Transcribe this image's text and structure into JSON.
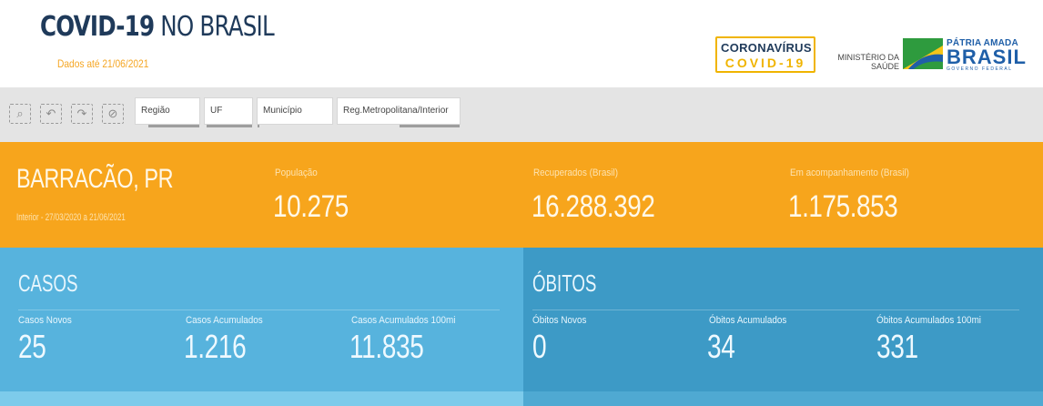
{
  "header": {
    "title_bold": "COVID-19",
    "title_light": " NO BRASIL",
    "date_note": "Dados até 21/06/2021",
    "logo_corona_line1": "CORONAVÍRUS",
    "logo_corona_line2": "COVID-19",
    "logo_ministerio_line1": "MINISTÉRIO DA",
    "logo_ministerio_line2": "SAÚDE",
    "logo_patria_line1": "PÁTRIA AMADA",
    "logo_patria_line2": "BRASIL",
    "logo_patria_line3": "GOVERNO FEDERAL"
  },
  "toolbar": {
    "tools": [
      {
        "icon": "zoom-selection-icon",
        "glyph": "⌕"
      },
      {
        "icon": "back-icon",
        "glyph": "↶"
      },
      {
        "icon": "forward-icon",
        "glyph": "↷"
      },
      {
        "icon": "clear-selection-icon",
        "glyph": "⊘"
      }
    ],
    "filters": [
      "Região",
      "UF",
      "Município",
      "Reg.Metropolitana/Interior"
    ]
  },
  "summary": {
    "city": "BARRACÃO, PR",
    "period": "Interior - 27/03/2020 a 21/06/2021",
    "population_label": "População",
    "population_value": "10.275",
    "recovered_label": "Recuperados (Brasil)",
    "recovered_value": "16.288.392",
    "monitoring_label": "Em acompanhamento (Brasil)",
    "monitoring_value": "1.175.853"
  },
  "casos": {
    "title": "CASOS",
    "new_label": "Casos Novos",
    "new_value": "25",
    "cumulative_label": "Casos Acumulados",
    "cumulative_value": "1.216",
    "per100k_label": "Casos Acumulados 100mi",
    "per100k_value": "11.835"
  },
  "obitos": {
    "title": "ÓBITOS",
    "new_label": "Óbitos Novos",
    "new_value": "0",
    "cumulative_label": "Óbitos Acumulados",
    "cumulative_value": "34",
    "per100k_label": "Óbitos Acumulados 100mi",
    "per100k_value": "331"
  },
  "colors": {
    "orange_band": "#f7a51c",
    "casos_panel": "#57b3dd",
    "obitos_panel": "#3d9ac6",
    "title_navy": "#1f3a5a"
  }
}
